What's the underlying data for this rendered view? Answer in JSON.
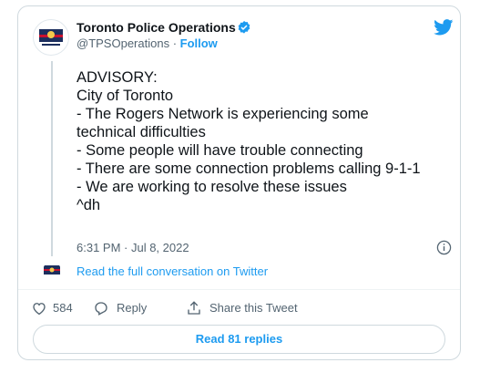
{
  "author": {
    "name": "Toronto Police Operations",
    "handle": "@TPSOperations",
    "separator": " · ",
    "follow_label": "Follow"
  },
  "tweet": {
    "lines": [
      "ADVISORY:",
      "City of Toronto",
      "- The Rogers Network is experiencing some",
      "technical difficulties",
      "- Some people will have trouble connecting",
      "- There are some connection problems calling 9-1-1",
      "- We are working to resolve these issues",
      "^dh"
    ],
    "timestamp": "6:31 PM · Jul 8, 2022"
  },
  "conversation_link": "Read the full conversation on Twitter",
  "actions": {
    "like_count": "584",
    "reply_label": "Reply",
    "share_label": "Share this Tweet"
  },
  "read_replies_label": "Read 81 replies",
  "colors": {
    "twitter_blue": "#1d9bf0",
    "secondary_text": "#536471",
    "border": "#cfd9de"
  },
  "icons": [
    "police-logo-icon",
    "verified-badge-icon",
    "twitter-bird-icon",
    "info-icon",
    "heart-icon",
    "reply-icon",
    "share-icon"
  ]
}
